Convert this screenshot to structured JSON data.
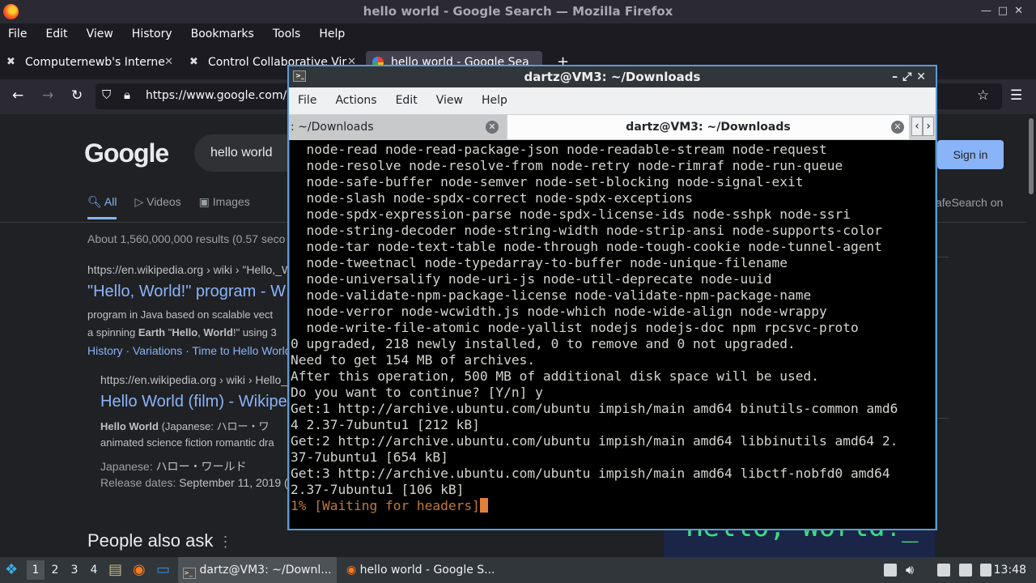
{
  "firefox": {
    "window_title": "hello world - Google Search — Mozilla Firefox",
    "menu": [
      "File",
      "Edit",
      "View",
      "History",
      "Bookmarks",
      "Tools",
      "Help"
    ],
    "tabs": [
      {
        "label": "Computernewb's Interne"
      },
      {
        "label": "Control Collaborative Vir"
      },
      {
        "label": "hello world - Google Sea"
      }
    ],
    "new_tab": "+",
    "url_host": "https://www.google.com/"
  },
  "google": {
    "logo": "Google",
    "query": "hello world",
    "signin": "Sign in",
    "tabs": [
      "All",
      "Videos",
      "Images"
    ],
    "safesearch": "afeSearch on",
    "stats": "About 1,560,000,000 results (0.57 seco",
    "results": [
      {
        "cite": "https://en.wikipedia.org › wiki › \"Hello,_W",
        "title": "\"Hello, World!\" program - W",
        "snippet1": "program in Java based on scalable vect",
        "snippet2_pre": "a spinning ",
        "snippet2_b1": "Earth",
        "snippet2_mid1": " \"",
        "snippet2_b2": "Hello",
        "snippet2_mid2": ", ",
        "snippet2_b3": "World",
        "snippet2_post": "!\" using 3",
        "links": "History · Variations · Time to Hello World"
      },
      {
        "cite": "https://en.wikipedia.org › wiki › Hello_",
        "title": "Hello World (film) - Wikipe",
        "snippet1_b": "Hello World",
        "snippet1_post": " (Japanese: ハロー・ワ",
        "snippet2": "animated science fiction romantic dra",
        "fact1_label": "Japanese:",
        "fact1_value": "ハロー・ワールド",
        "fact2_label": "Release dates:",
        "fact2_value": "September 11, 2019 ("
      }
    ],
    "people_also_ask": "People also ask",
    "kp_image_text": "Hello, World!_"
  },
  "terminal": {
    "title": "dartz@VM3: ~/Downloads",
    "menu": [
      "File",
      "Actions",
      "Edit",
      "View",
      "Help"
    ],
    "tab1": ": ~/Downloads",
    "tab2": "dartz@VM3: ~/Downloads",
    "lines": [
      "  node-read node-read-package-json node-readable-stream node-request",
      "  node-resolve node-resolve-from node-retry node-rimraf node-run-queue",
      "  node-safe-buffer node-semver node-set-blocking node-signal-exit",
      "  node-slash node-spdx-correct node-spdx-exceptions",
      "  node-spdx-expression-parse node-spdx-license-ids node-sshpk node-ssri",
      "  node-string-decoder node-string-width node-strip-ansi node-supports-color",
      "  node-tar node-text-table node-through node-tough-cookie node-tunnel-agent",
      "  node-tweetnacl node-typedarray-to-buffer node-unique-filename",
      "  node-universalify node-uri-js node-util-deprecate node-uuid",
      "  node-validate-npm-package-license node-validate-npm-package-name",
      "  node-verror node-wcwidth.js node-which node-wide-align node-wrappy",
      "  node-write-file-atomic node-yallist nodejs nodejs-doc npm rpcsvc-proto",
      "0 upgraded, 218 newly installed, 0 to remove and 0 not upgraded.",
      "Need to get 154 MB of archives.",
      "After this operation, 500 MB of additional disk space will be used.",
      "Do you want to continue? [Y/n] y",
      "Get:1 http://archive.ubuntu.com/ubuntu impish/main amd64 binutils-common amd6",
      "4 2.37-7ubuntu1 [212 kB]",
      "Get:2 http://archive.ubuntu.com/ubuntu impish/main amd64 libbinutils amd64 2.",
      "37-7ubuntu1 [654 kB]",
      "Get:3 http://archive.ubuntu.com/ubuntu impish/main amd64 libctf-nobfd0 amd64",
      "2.37-7ubuntu1 [106 kB]"
    ],
    "progress_line": "1% [Waiting for headers]"
  },
  "taskbar": {
    "workspaces": [
      "1",
      "2",
      "3",
      "4"
    ],
    "tasks": [
      "dartz@VM3: ~/Downl...",
      "hello world - Google S..."
    ],
    "clock": "13:48"
  }
}
